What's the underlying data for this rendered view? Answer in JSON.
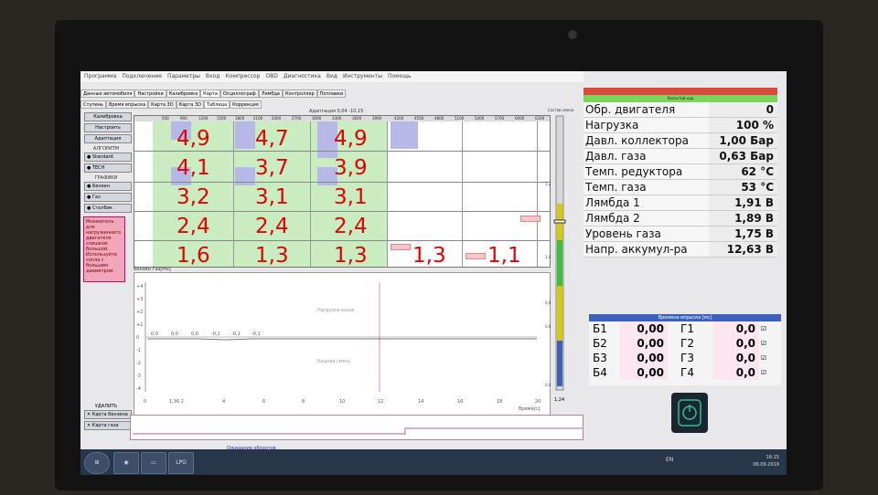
{
  "menu": [
    "Программа",
    "Подключение",
    "Параметры",
    "Вход",
    "Компрессор",
    "OBD",
    "Диагностика",
    "Вид",
    "Инструменты",
    "Помощь"
  ],
  "tabs_row1": [
    "Данные автомобиля",
    "Настройки",
    "Калибровка",
    "Карта",
    "Осциллограф",
    "Лямбда",
    "Контроллер",
    "Поплавки"
  ],
  "tabs_row2": [
    "Ступень",
    "Время впрыска",
    "Карта 3D",
    "Карта 3D",
    "Таблица",
    "Коррекция"
  ],
  "left": {
    "calibration": "Калибровка",
    "settings": "Настроить",
    "adaptation": "Адаптация",
    "algorithm_head": "АЛГОРИТМ",
    "standard": "Standard",
    "tech": "TECH",
    "graphs_head": "ГРАФИКИ",
    "petrol": "Бензин",
    "gas": "Газ",
    "column": "Столбик",
    "warning": "Множитель для нагруженного двигателя слишком большой. Используйте сопла с большим диаметром."
  },
  "grid": {
    "adaptation_label": "Адаптация",
    "adaptation_values": "0,04  -10,15",
    "rpm_headers": [
      "500",
      "900",
      "1200",
      "1500",
      "1800",
      "2100",
      "2400",
      "2700",
      "3000",
      "3300",
      "3600",
      "3900",
      "4200",
      "4500",
      "4800",
      "5100",
      "5400",
      "5700",
      "6000",
      "6300"
    ],
    "values": [
      {
        "text": "4,9"
      },
      {
        "text": "4,7"
      },
      {
        "text": "4,9"
      },
      {
        "text": "4,1"
      },
      {
        "text": "3,7"
      },
      {
        "text": "3,9"
      },
      {
        "text": "3,2"
      },
      {
        "text": "3,1"
      },
      {
        "text": "3,1"
      },
      {
        "text": "2,4"
      },
      {
        "text": "2,4"
      },
      {
        "text": "2,4"
      },
      {
        "text": "1,6"
      },
      {
        "text": "1,3"
      },
      {
        "text": "1,3"
      },
      {
        "text": "1,3"
      },
      {
        "text": "1,1"
      }
    ]
  },
  "graph": {
    "title": "Бензин Газ[ms]",
    "x_ticks": [
      "0",
      "1,36 2",
      "4",
      "6",
      "8",
      "10",
      "12",
      "14",
      "16",
      "18",
      "20"
    ],
    "y_ticks": [
      "+4",
      "+3",
      "+2",
      "+1",
      "0",
      "-1",
      "-2",
      "-3",
      "-4"
    ],
    "upper_note": "Нагрузка выше",
    "lower_note": "Бедная смесь",
    "xlabel": "Время[с]",
    "point_labels": [
      "0,0",
      "0,0",
      "0,0",
      "-0,1",
      "-0,1",
      "-0,1"
    ]
  },
  "delete": {
    "head": "УДАЛИТЬ",
    "petrol_map": "Карта бензина",
    "gas_map": "Карта газа"
  },
  "status": "Ожидание оборотов",
  "scale": {
    "title": "Состав смеси",
    "value": "1,24",
    "labels": [
      "1,2",
      "1,0",
      "0,8",
      "0,6",
      "0,0"
    ]
  },
  "right": {
    "state_label": "Холостой ход",
    "rows": [
      {
        "label": "Обр. двигателя",
        "value": "0"
      },
      {
        "label": "Нагрузка",
        "value": "100 %"
      },
      {
        "label": "Давл. коллектора",
        "value": "1,00 Бар"
      },
      {
        "label": "Давл. газа",
        "value": "0,63 Бар"
      },
      {
        "label": "Темп. редуктора",
        "value": "62 °C"
      },
      {
        "label": "Темп. газа",
        "value": "53 °C"
      },
      {
        "label": "Лямбда 1",
        "value": "1,91 В"
      },
      {
        "label": "Лямбда 2",
        "value": "1,89 В"
      },
      {
        "label": "Уровень газа",
        "value": "1,75 В"
      },
      {
        "label": "Напр. аккумул-ра",
        "value": "12,63 В"
      }
    ]
  },
  "injection": {
    "title": "Времена впрыска [мс]",
    "rows": [
      {
        "b": "Б1",
        "bv": "0,00",
        "g": "Г1",
        "gv": "0,0"
      },
      {
        "b": "Б2",
        "bv": "0,00",
        "g": "Г2",
        "gv": "0,0"
      },
      {
        "b": "Б3",
        "bv": "0,00",
        "g": "Г3",
        "gv": "0,0"
      },
      {
        "b": "Б4",
        "bv": "0,00",
        "g": "Г4",
        "gv": "0,0"
      }
    ]
  },
  "taskbar": {
    "lang": "EN",
    "time": "16:15",
    "date": "06.09.2019",
    "app": "LPG TECH"
  },
  "colors": {
    "red": "#d00000",
    "green": "#c9ecc0",
    "blue": "#3c62b8"
  }
}
